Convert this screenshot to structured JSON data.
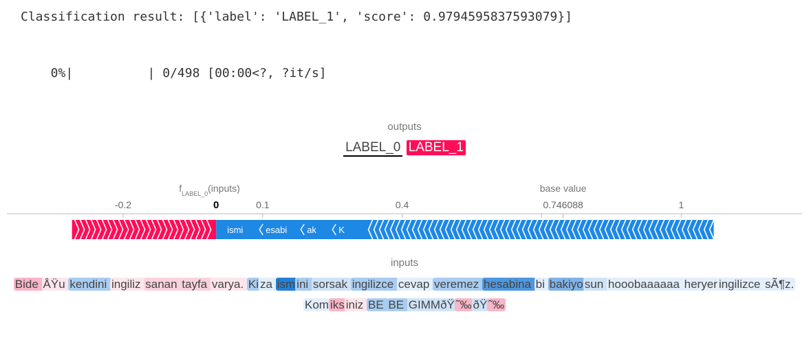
{
  "console": {
    "result": "Classification result: [{'label': 'LABEL_1', 'score': 0.9794595837593079}]",
    "progress": "  0%|          | 0/498 [00:00<?, ?it/s]"
  },
  "outputs": {
    "title": "outputs",
    "labels": [
      "LABEL_0",
      "LABEL_1"
    ],
    "selected": "LABEL_0"
  },
  "plot": {
    "f_label": "f",
    "f_sub": "LABEL_0",
    "f_suffix": "(inputs)",
    "base_label": "base value",
    "value_label": "0",
    "base_value_label": "0.746088",
    "axis_min": -0.45,
    "axis_max": 1.26,
    "value": 0.0,
    "base_value": 0.746088,
    "ticks": [
      {
        "v": -0.2,
        "label": "-0.2"
      },
      {
        "v": 0.1,
        "label": "0.1"
      },
      {
        "v": 0.4,
        "label": "0.4"
      },
      {
        "v": 0.7,
        "label": ""
      },
      {
        "v": 1.0,
        "label": "1"
      }
    ],
    "pos_range": [
      -0.31,
      0.0
    ],
    "neg_range": [
      0.0,
      1.07
    ],
    "pos_labels": [],
    "neg_labels": [
      "ismi",
      "esabi",
      "ak",
      "K"
    ],
    "colors": {
      "pos": "#ff0d57",
      "neg": "#1e88e5"
    }
  },
  "inputs": {
    "title": "inputs",
    "tokens": [
      {
        "t": "Bide ",
        "c": "#f8b6c8"
      },
      {
        "t": "ÅŸu ",
        "c": "#fce6ec"
      },
      {
        "t": "kendini ",
        "c": "#a9cdf2"
      },
      {
        "t": "ingiliz ",
        "c": "#fce6ec"
      },
      {
        "t": "sanan ",
        "c": "#fad2dd"
      },
      {
        "t": "tayfa ",
        "c": "#fad2dd"
      },
      {
        "t": "varya. ",
        "c": "#fce6ec"
      },
      {
        "t": "Ki",
        "c": "#a9cdf2"
      },
      {
        "t": "za ",
        "c": "#e3effb"
      },
      {
        "t": "ism",
        "c": "#2680d6"
      },
      {
        "t": "ini ",
        "c": "#a9cdf2"
      },
      {
        "t": "sorsak ",
        "c": "#cfe3f7"
      },
      {
        "t": "ingilizce ",
        "c": "#a9cdf2"
      },
      {
        "t": "cevap ",
        "c": "#e3effb"
      },
      {
        "t": "veremez ",
        "c": "#a9cdf2"
      },
      {
        "t": "hesabina ",
        "c": "#4f97df"
      },
      {
        "t": "bi ",
        "c": "#e3effb"
      },
      {
        "t": "bakiyo",
        "c": "#80b3e8"
      },
      {
        "t": "sun ",
        "c": "#cfe3f7"
      },
      {
        "t": "hooobaaaaaa ",
        "c": "#e3effb"
      },
      {
        "t": "heryer",
        "c": "#e3effb"
      },
      {
        "t": "ingilizce ",
        "c": "#e3effb"
      },
      {
        "t": "sÃ¶z. ",
        "c": "#e3effb"
      },
      {
        "t": "Kom",
        "c": "#e3effb"
      },
      {
        "t": "iks",
        "c": "#f8b6c8"
      },
      {
        "t": "iniz ",
        "c": "#fce6ec"
      },
      {
        "t": "BE ",
        "c": "#a9cdf2"
      },
      {
        "t": "BE ",
        "c": "#a9cdf2"
      },
      {
        "t": "GIMMðŸ",
        "c": "#cfe3f7"
      },
      {
        "t": "˜‰",
        "c": "#f8b6c8"
      },
      {
        "t": "ðŸ",
        "c": "#cfe3f7"
      },
      {
        "t": "˜‰",
        "c": "#f8b6c8"
      }
    ]
  }
}
